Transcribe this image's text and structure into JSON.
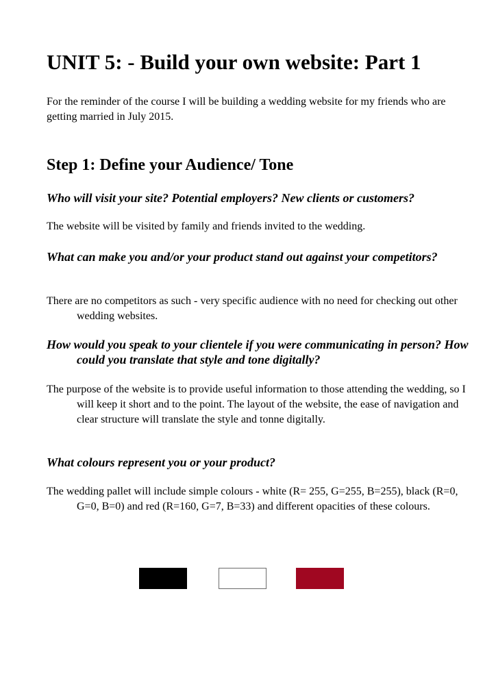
{
  "title": "UNIT 5: - Build your own website: Part 1",
  "intro": "For the reminder of the course I will be building a wedding website for my friends who are getting married in July 2015.",
  "step": {
    "heading": "Step 1: Define your Audience/ Tone",
    "qa": [
      {
        "question": "Who will visit your site? Potential employers? New clients or customers?",
        "answer": "The website will be visited by family and friends invited to the wedding."
      },
      {
        "question": "What can make you and/or your product stand out against your competitors?",
        "answer": "There are no competitors as such - very specific audience with no need for checking out other wedding websites."
      },
      {
        "question": "How would you speak to your clientele if you were communicating in person? How could you translate that style and tone digitally?",
        "answer": "The purpose of the website is to provide useful information to those attending the wedding, so I will keep it short and to the point. The layout of the website, the ease of navigation and clear structure will translate the style and tonne digitally."
      },
      {
        "question": "What colours represent you or your product?",
        "answer": "The wedding pallet will include simple colours - white (R= 255, G=255, B=255), black (R=0, G=0, B=0) and red (R=160, G=7, B=33) and different opacities of these colours."
      }
    ]
  },
  "palette": {
    "swatches": [
      {
        "name": "black",
        "color": "#000000"
      },
      {
        "name": "white",
        "color": "#ffffff"
      },
      {
        "name": "red",
        "color": "#a00721"
      }
    ]
  }
}
